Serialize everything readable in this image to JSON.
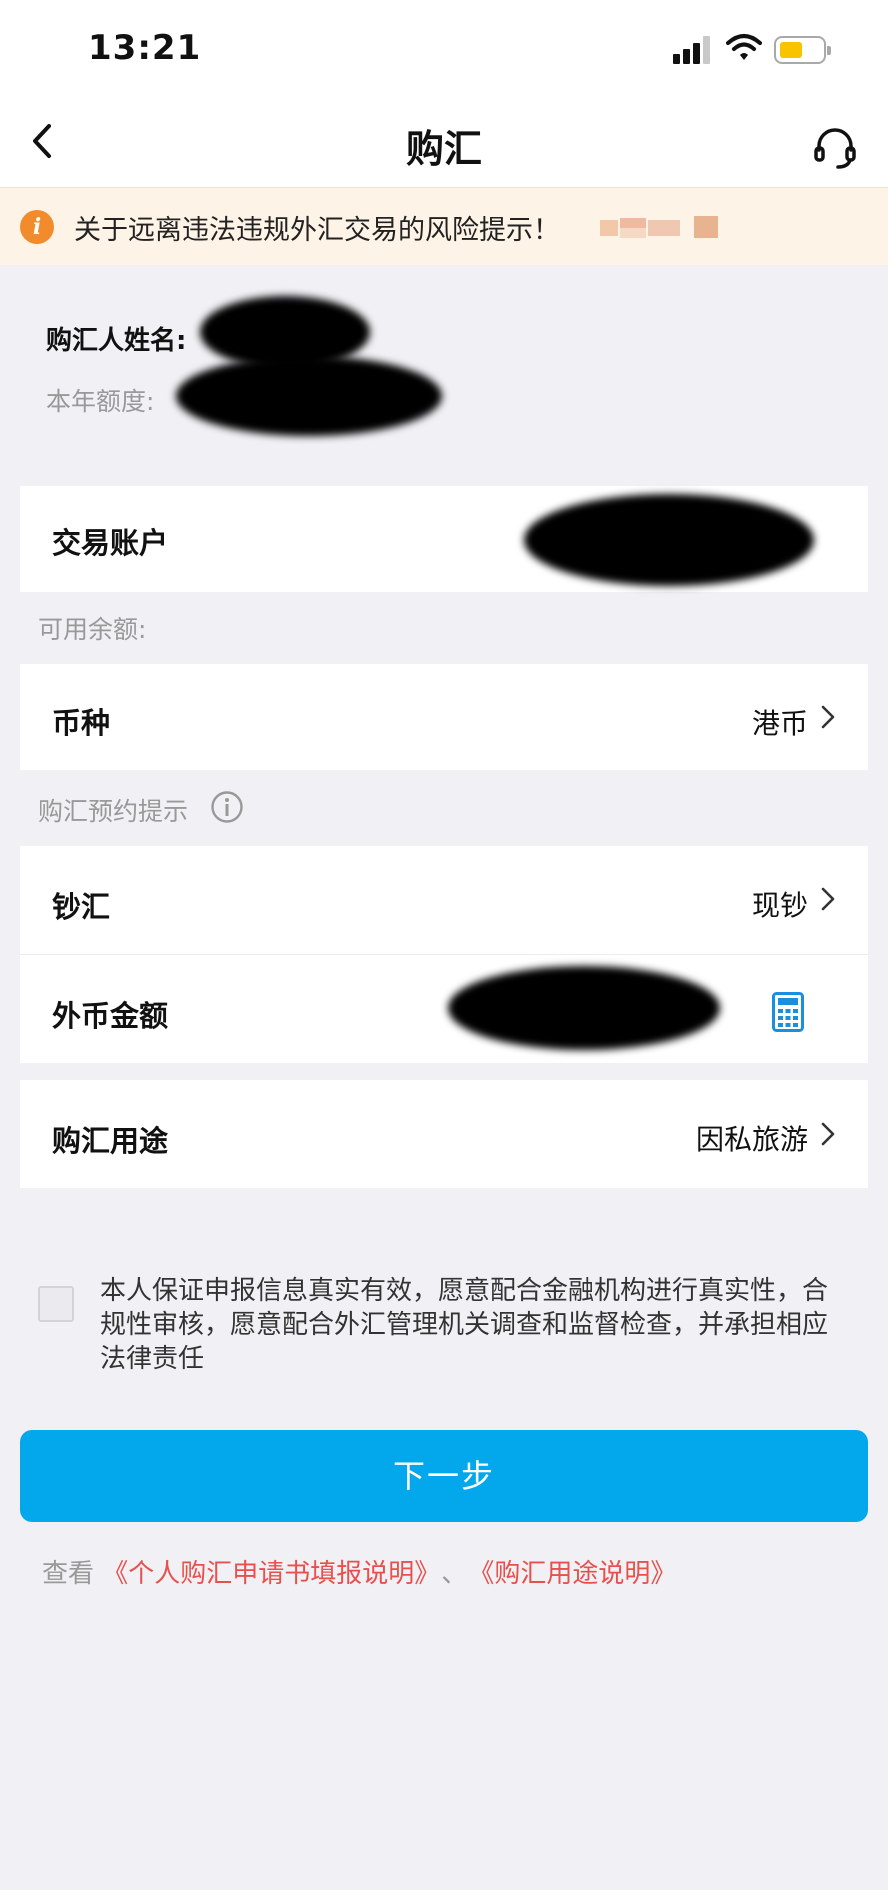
{
  "status_bar": {
    "time": "13:21"
  },
  "nav": {
    "title": "购汇"
  },
  "notice": {
    "text": "关于远离违法违规外汇交易的风险提示！"
  },
  "payer": {
    "name_label": "购汇人姓名:",
    "quota_label": "本年额度:"
  },
  "account": {
    "label": "交易账户",
    "balance_label": "可用余额:"
  },
  "currency": {
    "label": "币种",
    "value": "港币"
  },
  "reservation_hint": {
    "label": "购汇预约提示"
  },
  "cash_type": {
    "label": "钞汇",
    "value": "现钞"
  },
  "amount": {
    "label": "外币金额"
  },
  "purpose": {
    "label": "购汇用途",
    "value": "因私旅游"
  },
  "agreement": {
    "text": "本人保证申报信息真实有效，愿意配合金融机构进行真实性，合规性审核，愿意配合外汇管理机关调查和监督检查，并承担相应法律责任"
  },
  "next_button": {
    "label": "下一步"
  },
  "links": {
    "prefix": "查看",
    "guide": "《个人购汇申请书填报说明》",
    "separator": "、",
    "purpose_guide": "《购汇用途说明》"
  },
  "colors": {
    "primary": "#03a8ec",
    "link_red": "#e8504e",
    "notice_bg": "#fdf3e6",
    "notice_icon": "#f28b2b",
    "battery": "#f8c400"
  },
  "icons": {
    "back": "chevron-left-icon",
    "service": "headset-icon",
    "notice": "info-icon",
    "hint": "info-circle-icon",
    "amount": "calculator-icon",
    "row": "chevron-right-icon"
  }
}
